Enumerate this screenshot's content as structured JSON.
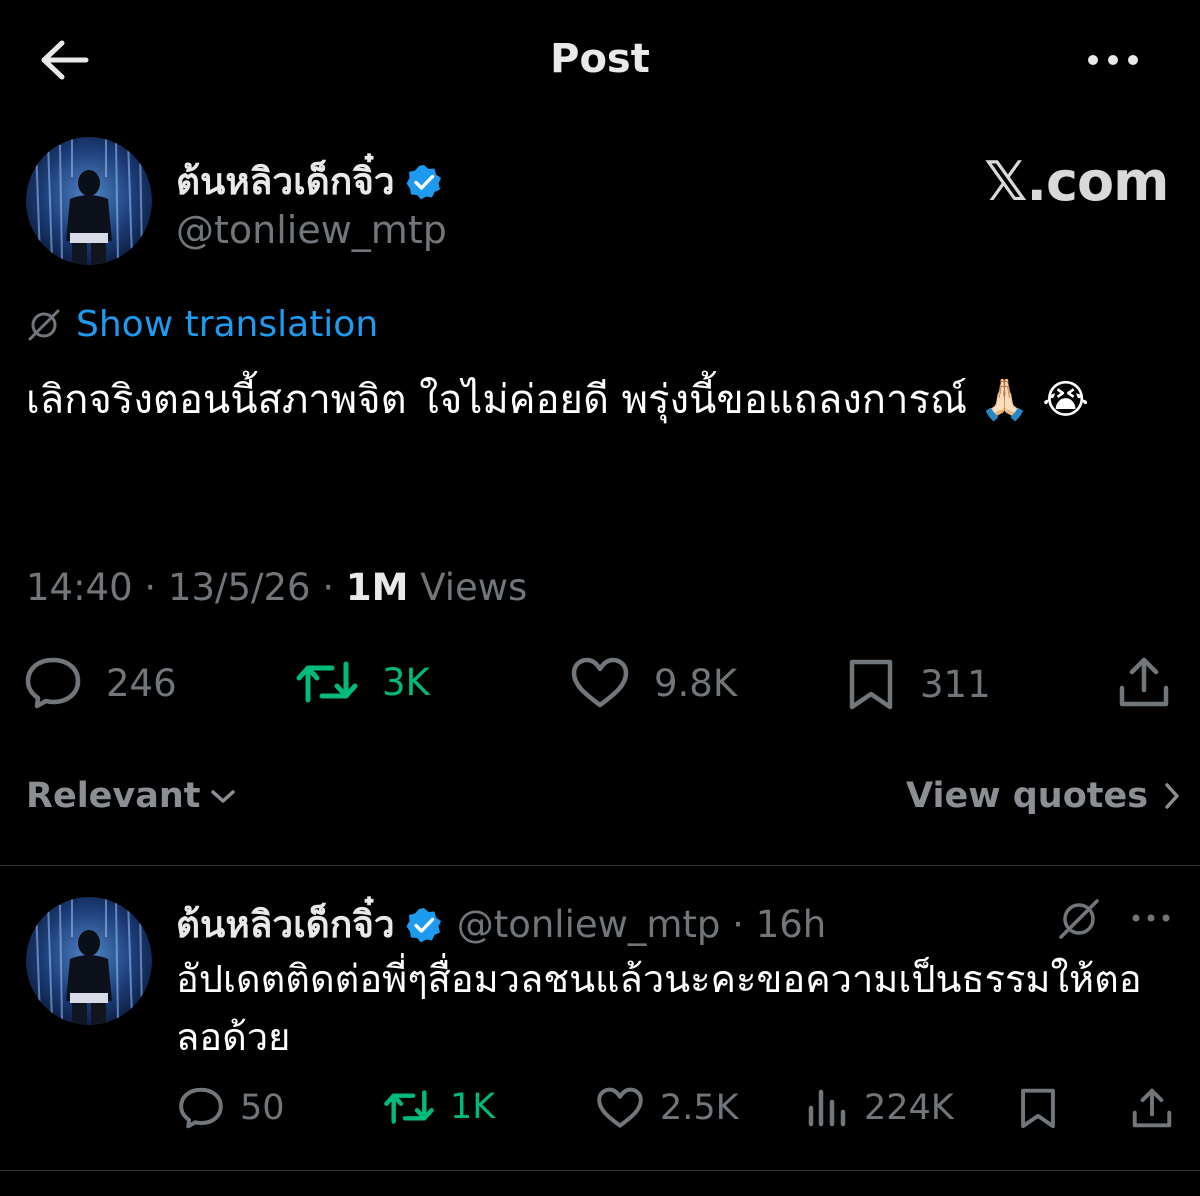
{
  "header": {
    "title": "Post",
    "back_icon": "arrow-left-icon",
    "more_icon": "more-horizontal-icon"
  },
  "main_post": {
    "author_name": "ต้นหลิวเด็กจิ๋ว",
    "handle": "@tonliew_mtp",
    "watermark": "𝕏.com",
    "translate_label": "Show translation",
    "text": "เลิกจริงตอนนี้สภาพจิต ใจไม่ค่อยดี พรุ่งนี้ขอแถลงการณ์ 🙏🏻 😭",
    "time": "14:40",
    "date": "13/5/26",
    "views_count": "1M",
    "views_label": "Views",
    "stats": {
      "replies": "246",
      "reposts": "3K",
      "likes": "9.8K",
      "bookmarks": "311"
    }
  },
  "filters": {
    "sort_label": "Relevant",
    "quotes_label": "View quotes"
  },
  "reply": {
    "author_name": "ต้นหลิวเด็กจิ๋ว",
    "handle_time": "@tonliew_mtp · 16h",
    "text": "อัปเดตติดต่อพี่ๆสื่อมวลชนแล้วนะคะขอความเป็นธรรมให้ตอลอด้วย",
    "stats": {
      "replies": "50",
      "reposts": "1K",
      "likes": "2.5K",
      "views": "224K"
    }
  },
  "colors": {
    "background": "#000000",
    "text": "#e7e9ea",
    "muted": "#71767b",
    "link": "#1d9bf0",
    "repost": "#00ba7c",
    "verified": "#1d9bf0",
    "divider": "#2f3336"
  }
}
